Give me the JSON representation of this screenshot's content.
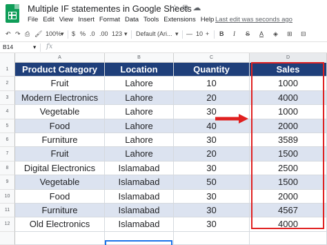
{
  "app": {
    "doc_title": "Multiple IF statementes in Google Sheets",
    "title_icons": [
      "star-icon",
      "move-to-folder-icon",
      "cloud-status-icon"
    ],
    "menu": [
      "File",
      "Edit",
      "View",
      "Insert",
      "Format",
      "Data",
      "Tools",
      "Extensions",
      "Help"
    ],
    "last_edit": "Last edit was seconds ago"
  },
  "toolbar": {
    "undo": "↶",
    "redo": "↷",
    "print": "⎙",
    "paint_format": "🖌",
    "zoom": "100%",
    "zoom_caret": "▾",
    "currency": "$",
    "percent": "%",
    "decimal_decrease": ".0",
    "decimal_increase": ".00",
    "more_formats": "123",
    "more_formats_caret": "▾",
    "font": "Default (Ari...",
    "font_caret": "▾",
    "font_size_decrease": "—",
    "font_size": "10",
    "font_size_increase": "+",
    "bold": "B",
    "italic": "I",
    "strikethrough": "S",
    "text_color": "A",
    "fill_color": "◈",
    "borders": "⊞",
    "merge": "⊟"
  },
  "formula_bar": {
    "name_box": "B14",
    "name_box_caret": "▾",
    "fx": "fx",
    "value": ""
  },
  "columns": [
    "A",
    "B",
    "C",
    "D"
  ],
  "rows": [
    "1",
    "2",
    "3",
    "4",
    "5",
    "6",
    "7",
    "8",
    "9",
    "10",
    "11",
    "12"
  ],
  "table": {
    "headers": [
      "Product Category",
      "Location",
      "Quantity",
      "Sales"
    ],
    "rows": [
      [
        "Fruit",
        "Lahore",
        "10",
        "1000"
      ],
      [
        "Modern Electronics",
        "Lahore",
        "20",
        "4000"
      ],
      [
        "Vegetable",
        "Lahore",
        "30",
        "1000"
      ],
      [
        "Food",
        "Lahore",
        "40",
        "2000"
      ],
      [
        "Furniture",
        "Lahore",
        "30",
        "3589"
      ],
      [
        "Fruit",
        "Lahore",
        "20",
        "1500"
      ],
      [
        "Digital Electronics",
        "Islamabad",
        "30",
        "2500"
      ],
      [
        "Vegetable",
        "Islamabad",
        "50",
        "1500"
      ],
      [
        "Food",
        "Islamabad",
        "30",
        "2000"
      ],
      [
        "Furniture",
        "Islamabad",
        "30",
        "4567"
      ],
      [
        "Old Electronics",
        "Islamabad",
        "30",
        "4000"
      ]
    ]
  },
  "colors": {
    "header_bg": "#1f3f7a",
    "band_bg": "#dce3f0",
    "highlight": "#e02020",
    "sheets_green": "#0f9d58"
  }
}
